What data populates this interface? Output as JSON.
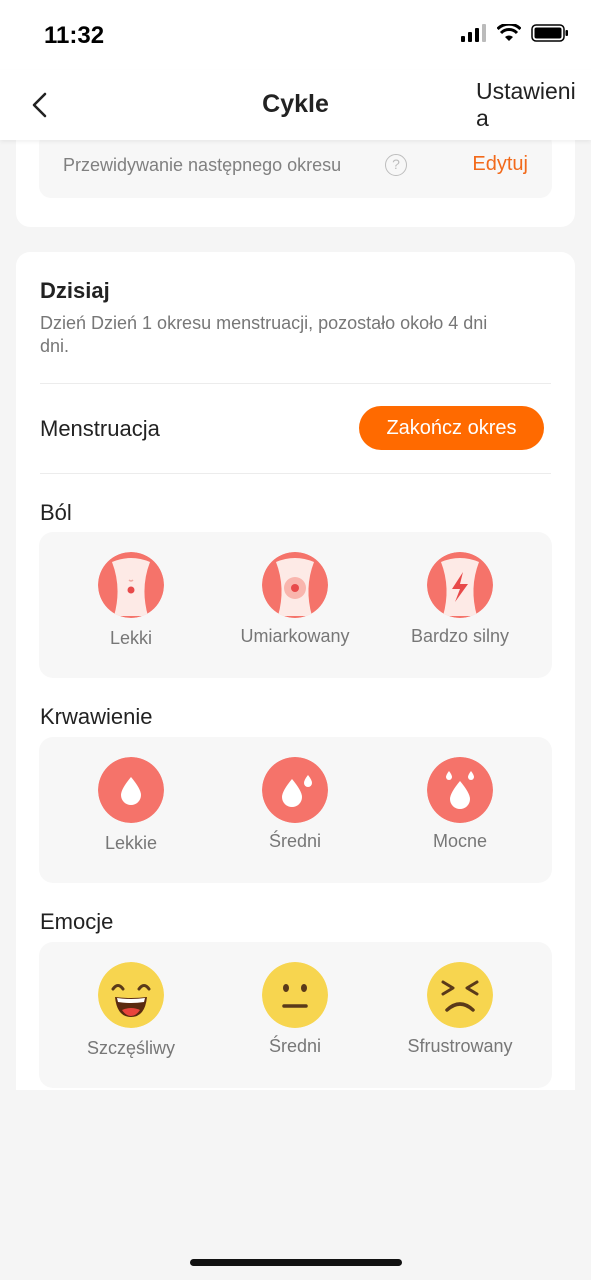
{
  "status_bar": {
    "time": "11:32"
  },
  "header": {
    "title": "Cykle",
    "settings_label": "Ustawienia"
  },
  "prediction": {
    "label": "Przewidywanie następnego okresu",
    "help_glyph": "?",
    "edit_label": "Edytuj"
  },
  "today": {
    "title": "Dzisiaj",
    "description": "Dzień Dzień 1 okresu menstruacji, pozostało około 4 dni dni."
  },
  "menstruation": {
    "label": "Menstruacja",
    "end_button_label": "Zakończ okres"
  },
  "pain": {
    "title": "Ból",
    "options": [
      {
        "label": "Lekki",
        "icon": "pain-light-icon"
      },
      {
        "label": "Umiarkowany",
        "icon": "pain-moderate-icon"
      },
      {
        "label": "Bardzo silny",
        "icon": "pain-severe-icon"
      }
    ]
  },
  "bleeding": {
    "title": "Krwawienie",
    "options": [
      {
        "label": "Lekkie",
        "icon": "drop-light-icon"
      },
      {
        "label": "Średni",
        "icon": "drop-medium-icon"
      },
      {
        "label": "Mocne",
        "icon": "drop-heavy-icon"
      }
    ]
  },
  "emotions": {
    "title": "Emocje",
    "options": [
      {
        "label": "Szczęśliwy",
        "icon": "happy-face-icon"
      },
      {
        "label": "Średni",
        "icon": "neutral-face-icon"
      },
      {
        "label": "Sfrustrowany",
        "icon": "frustrated-face-icon"
      }
    ]
  },
  "colors": {
    "accent": "#ff6a00",
    "edit_link": "#f26a1b",
    "icon_red": "#f5736a",
    "face_yellow": "#f7d54f"
  }
}
